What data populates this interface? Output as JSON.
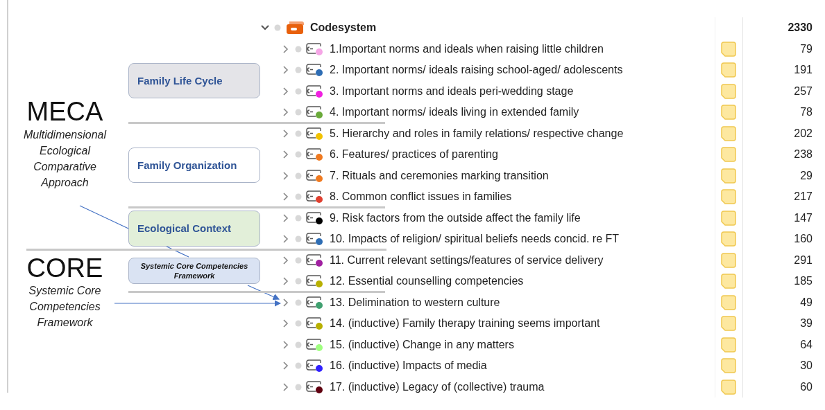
{
  "root": {
    "label": "Codesystem",
    "count": "2330",
    "expanded": true
  },
  "frameworks": [
    {
      "title": "MECA",
      "subtitle": "Multidimensional Ecological Comparative Approach",
      "groups": [
        {
          "category": {
            "label": "Family Life Cycle",
            "kind": "heading",
            "color": "#e4e4e8"
          },
          "codes": [
            {
              "label": "1.Important norms and ideals when raising little children",
              "color": "#f5a6e6",
              "count": "79",
              "memo": true
            },
            {
              "label": "2. Important norms/ ideals raising school-aged/ adolescents",
              "color": "#2e6db4",
              "count": "191",
              "memo": true
            },
            {
              "label": "3. Important norms and ideals peri-wedding stage",
              "color": "#f020e0",
              "count": "257",
              "memo": true
            },
            {
              "label": "4. Important norms/ ideals living in extended family",
              "color": "#6aaa3a",
              "count": "78",
              "memo": true
            }
          ]
        },
        {
          "category": {
            "label": "Family Organization",
            "kind": "heading",
            "color": "#ffffff"
          },
          "codes": [
            {
              "label": "5. Hierarchy and roles in family relations/ respective change",
              "color": "#f2c200",
              "count": "202",
              "memo": true
            },
            {
              "label": "6. Features/ practices of parenting",
              "color": "#f07a20",
              "count": "238",
              "memo": true
            },
            {
              "label": "7. Rituals and ceremonies marking transition",
              "color": "#f07a20",
              "count": "29",
              "memo": true
            },
            {
              "label": "8. Common conflict issues in families",
              "color": "#e04030",
              "count": "217",
              "memo": true
            }
          ]
        },
        {
          "category": {
            "label": "Ecological Context",
            "kind": "heading",
            "color": "#e2efd9"
          },
          "codes": [
            {
              "label": "9. Risk factors from the outside affect the family life",
              "color": "#000000",
              "count": "147",
              "memo": true
            },
            {
              "label": "10. Impacts of religion/ spiritual beliefs needs concid. re FT",
              "color": "#2e6db4",
              "count": "160",
              "memo": true
            }
          ]
        }
      ]
    },
    {
      "title": "CORE",
      "subtitle": "Systemic Core Competencies Framework",
      "groups": [
        {
          "category": {
            "label": "Systemic Core Competencies Framework",
            "kind": "caption",
            "color": "#dae3f3"
          },
          "codes": [
            {
              "label": "11. Current relevant settings/features of service delivery",
              "color": "#a020a0",
              "count": "291",
              "memo": true
            },
            {
              "label": "12. Essential counselling competencies",
              "color": "#b8b000",
              "count": "185",
              "memo": true
            }
          ]
        },
        {
          "codes": [
            {
              "label": "13. Delimination to western culture",
              "color": "#40a070",
              "count": "49",
              "memo": true
            },
            {
              "label": "14. (inductive) Family therapy training seems important",
              "color": "#b8b000",
              "count": "39",
              "memo": true
            },
            {
              "label": "15. (inductive) Change in any matters",
              "color": "#a0ff80",
              "count": "64",
              "memo": true
            },
            {
              "label": "16. (inductive) Impacts of media",
              "color": "#3020ff",
              "count": "30",
              "memo": true
            },
            {
              "label": "17. (inductive) Legacy of (collective) trauma",
              "color": "#600010",
              "count": "60",
              "memo": true
            }
          ]
        }
      ]
    }
  ]
}
